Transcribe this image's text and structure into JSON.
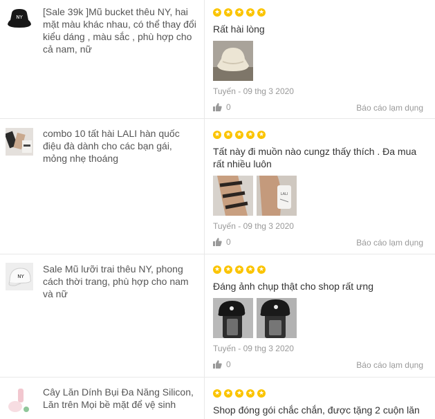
{
  "reviews": [
    {
      "product_name": "[Sale 39k ]Mũ bucket thêu NY, hai mặt màu khác nhau, có thể thay đổi kiểu dáng , màu sắc , phù hợp cho cả nam, nữ",
      "rating": 5,
      "comment": "Rất hài lòng",
      "author_date": "Tuyến - 09 thg 3 2020",
      "likes": "0",
      "report_label": "Báo cáo lạm dụng"
    },
    {
      "product_name": "combo 10 tất hài LALI hàn quốc điệu đà dành cho các bạn gái, mỏng nhẹ thoáng",
      "rating": 5,
      "comment": "Tất này đi muồn nào cungz thấy thích . Đa mua rất nhiều luôn",
      "author_date": "Tuyến - 09 thg 3 2020",
      "likes": "0",
      "report_label": "Báo cáo lạm dụng"
    },
    {
      "product_name": "Sale Mũ lưỡi trai thêu NY, phong cách thời trang, phù hợp cho nam và nữ",
      "rating": 5,
      "comment": "Đáng ảnh chụp thật cho shop rất ưng",
      "author_date": "Tuyến - 09 thg 3 2020",
      "likes": "0",
      "report_label": "Báo cáo lạm dụng"
    },
    {
      "product_name": "Cây Lăn Dính Bụi Đa Năng Silicon, Lăn trên Mọi bề mặt để vệ sinh",
      "rating": 5,
      "comment": "Shop đóng gói chắc chắn, được tặng 2 cuộn lăn"
    }
  ],
  "icons": {
    "star": "star-icon",
    "like": "thumbs-up-icon"
  },
  "colors": {
    "star": "#fbc400",
    "muted": "#999999",
    "border": "#e8e8e8"
  }
}
